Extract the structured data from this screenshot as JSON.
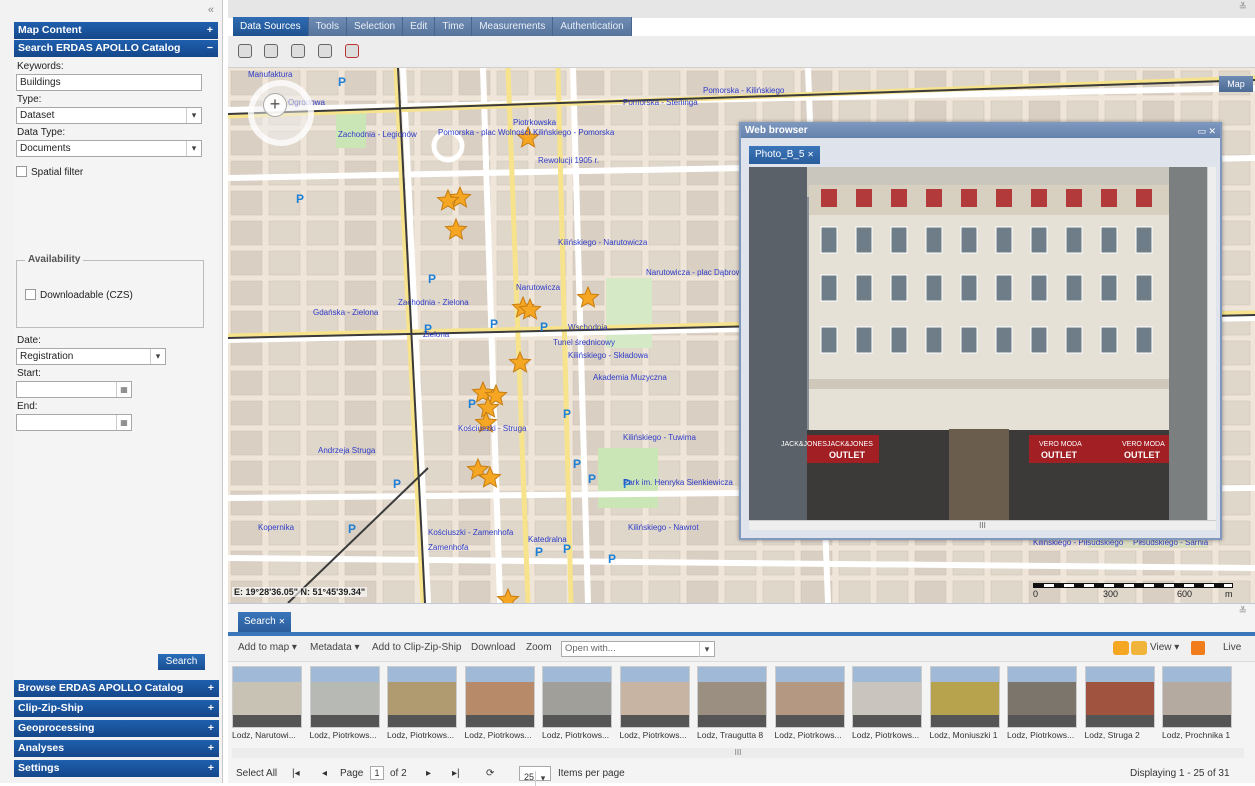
{
  "colors": {
    "accent": "#1f5fae",
    "star": "#f5a623",
    "map_bg": "#efe6d9"
  },
  "left": {
    "collapse_icon": "«",
    "map_content": "Map Content",
    "search_catalog": "Search ERDAS APOLLO Catalog",
    "keywords_label": "Keywords:",
    "keywords_value": "Buildings",
    "type_label": "Type:",
    "type_value": "Dataset",
    "datatype_label": "Data Type:",
    "datatype_value": "Documents",
    "spatial_filter": "Spatial filter",
    "availability": "Availability",
    "downloadable": "Downloadable (CZS)",
    "date_label": "Date:",
    "date_value": "Registration",
    "start_label": "Start:",
    "end_label": "End:",
    "search_btn": "Search",
    "browse": "Browse ERDAS APOLLO Catalog",
    "czs": "Clip-Zip-Ship",
    "geoprocessing": "Geoprocessing",
    "analyses": "Analyses",
    "settings": "Settings"
  },
  "tabs": [
    "Data Sources",
    "Tools",
    "Selection",
    "Edit",
    "Time",
    "Measurements",
    "Authentication"
  ],
  "map": {
    "map_button": "Map",
    "coords": "E: 19°28'36.05\"  N: 51°45'39.34\"",
    "scale_labels": [
      "0",
      "300",
      "600",
      "m"
    ],
    "street_labels": [
      "Manufaktura",
      "Ogrodowa",
      "Zachodnia - Legionów",
      "Pomorska - plac Wolności",
      "Kilińskiego - Pomorska",
      "Pomorska - Sterlinga",
      "Pomorska - Kilińskiego",
      "Rewolucji 1905 r.",
      "Narutowicza",
      "Kilińskiego - Narutowicza",
      "Narutowicza - plac Dąbrowskiego",
      "Tunel średnicowy",
      "Kilińskiego - Składowa",
      "Akademia Muzyczna",
      "Park im. Henryka Sienkiewicza",
      "Kilińskiego - Tuwima",
      "Kościuszki - Struga",
      "Andrzeja Struga",
      "Kilińskiego - Nawrot",
      "Katedralna",
      "Kościuszki - Zamenhofa",
      "Kilińskiego - Piłsudskiego",
      "Piłsudskiego - Sarnia",
      "Zachodnia - Zielona",
      "Gdańska - Zielona",
      "Zielona",
      "Wschodnia",
      "Piotrkowska",
      "Kopernika",
      "Zamenhofa"
    ]
  },
  "web": {
    "title": "Web browser",
    "tab": "Photo_B_5",
    "hscroll_label": "III",
    "signs": [
      "JACK&JONES",
      "JACK&JONES",
      "OUTLET",
      "VERO MODA",
      "OUTLET",
      "VERO MODA",
      "OUTLET"
    ]
  },
  "results": {
    "tab": "Search",
    "add_to_map": "Add to map",
    "metadata": "Metadata",
    "add_czs": "Add to Clip-Zip-Ship",
    "download": "Download",
    "zoom": "Zoom",
    "open_with": "Open with...",
    "view": "View",
    "live": "Live",
    "items": [
      "Lodz, Narutowi...",
      "Lodz, Piotrkows...",
      "Lodz, Piotrkows...",
      "Lodz, Piotrkows...",
      "Lodz, Piotrkows...",
      "Lodz, Piotrkows...",
      "Lodz, Traugutta 8",
      "Lodz, Piotrkows...",
      "Lodz, Piotrkows...",
      "Lodz, Moniuszki 1",
      "Lodz, Piotrkows...",
      "Lodz, Struga 2",
      "Lodz, Prochnika 1"
    ],
    "hscroll_label": "III",
    "select_all": "Select All",
    "page_label": "Page",
    "page": "1",
    "of": "of 2",
    "per_page": "25",
    "items_per_page": "Items per page",
    "displaying": "Displaying 1 - 25 of 31"
  }
}
